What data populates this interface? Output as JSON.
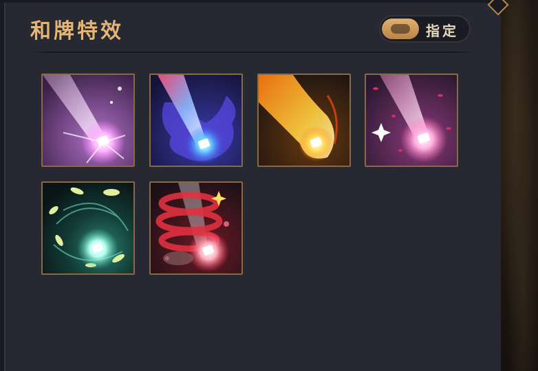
{
  "panel": {
    "title": "和牌特效",
    "toggle": {
      "label": "指定",
      "on": true
    }
  },
  "effects": [
    {
      "name": "pink-beam-effect",
      "theme": "#d88ae8",
      "selected": false
    },
    {
      "name": "blue-flame-beam-effect",
      "theme": "#5a6cff",
      "selected": false
    },
    {
      "name": "golden-fire-effect",
      "theme": "#ffb020",
      "selected": false
    },
    {
      "name": "rose-petal-beam-effect",
      "theme": "#f07ab0",
      "selected": false
    },
    {
      "name": "jade-leaf-vortex-effect",
      "theme": "#7fe0b0",
      "selected": false
    },
    {
      "name": "red-ribbon-burst-effect",
      "theme": "#e04050",
      "selected": true
    }
  ],
  "colors": {
    "accent": "#e6b574",
    "tile_border": "#8a6a46",
    "selection": "#f2cf8a"
  }
}
